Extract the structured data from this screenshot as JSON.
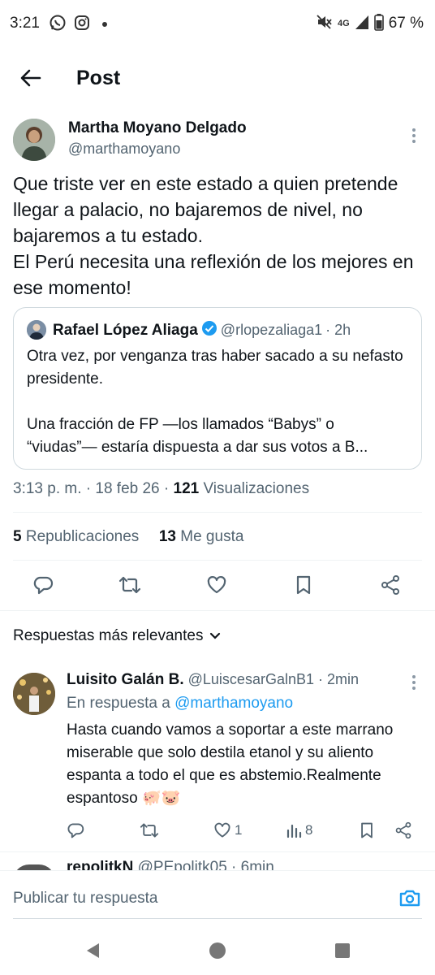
{
  "status_bar": {
    "time": "3:21",
    "network": "4G",
    "battery": "67 %",
    "icons": [
      "whatsapp-icon",
      "instagram-icon",
      "mute-icon",
      "signal-icon",
      "battery-icon"
    ]
  },
  "header": {
    "title": "Post"
  },
  "post": {
    "author_name": "Martha Moyano Delgado",
    "author_handle": "@marthamoyano",
    "text": "Que triste ver en este estado a quien pretende llegar a palacio, no bajaremos de nivel, no bajaremos a tu estado.\nEl Perú necesita una reflexión de los mejores en ese momento!",
    "quote": {
      "author_name": "Rafael López Aliaga",
      "author_handle": "@rlopezaliaga1",
      "time": "· 2h",
      "text": "Otra vez, por venganza tras haber sacado a su nefasto presidente.\n\nUna fracción de FP —los llamados “Babys” o “viudas”— estaría dispuesta a dar sus votos a B..."
    },
    "meta_time": "3:13 p. m. · 18 feb 26 · ",
    "views_count": "121",
    "views_label": " Visualizaciones",
    "reposts_count": "5",
    "reposts_label": " Republicaciones",
    "likes_count": "13",
    "likes_label": " Me gusta"
  },
  "replies_sort_label": "Respuestas más relevantes",
  "reply": {
    "author_name": "Luisito Galán B.",
    "author_handle": "@LuiscesarGalnB1",
    "time": "· 2min",
    "reply_to_prefix": "En respuesta a ",
    "reply_to_handle": "@marthamoyano",
    "text": "Hasta cuando vamos a soportar a este marrano miserable que solo destila etanol y su aliento espanta a todo el que es abstemio.Realmente espantoso 🐖🐷",
    "likes": "1",
    "views": "8"
  },
  "next_reply": {
    "author_name": "repolitkN",
    "author_handle": "@PEpolitk05",
    "time": "· 6min"
  },
  "compose": {
    "placeholder": "Publicar tu respuesta"
  },
  "colors": {
    "accent": "#1d9bf0",
    "text": "#0f1419",
    "secondary": "#536471"
  }
}
